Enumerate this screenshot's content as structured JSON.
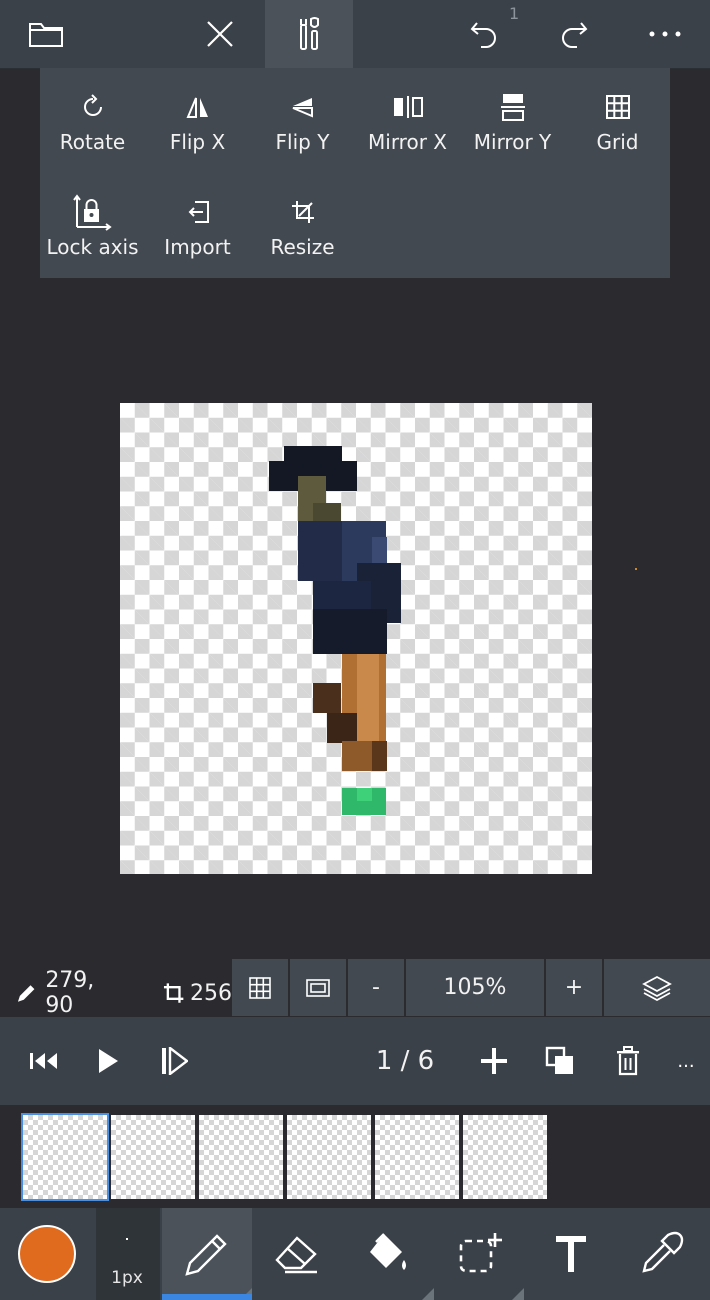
{
  "topbar": {
    "undo_count": "1"
  },
  "tools": [
    {
      "label": "Rotate"
    },
    {
      "label": "Flip X"
    },
    {
      "label": "Flip Y"
    },
    {
      "label": "Mirror X"
    },
    {
      "label": "Mirror Y"
    },
    {
      "label": "Grid"
    },
    {
      "label": "Lock axis"
    },
    {
      "label": "Import"
    },
    {
      "label": "Resize"
    }
  ],
  "status": {
    "cursor_coords": "279, 90",
    "canvas_size": "256",
    "zoom_out": "-",
    "zoom": "105%",
    "zoom_in": "+"
  },
  "animation": {
    "frame_counter": "1 / 6",
    "more": "..."
  },
  "frames": {
    "count": 6,
    "selected_index": 0
  },
  "bottom": {
    "brush_size": "1px",
    "primary_color": "#e06a1e",
    "active_tool": "pencil"
  },
  "colors": {
    "topbar_bg": "#3b4148",
    "panel_bg": "#434951",
    "workspace_bg": "#2b2b2f",
    "accent": "#3a86e0"
  }
}
